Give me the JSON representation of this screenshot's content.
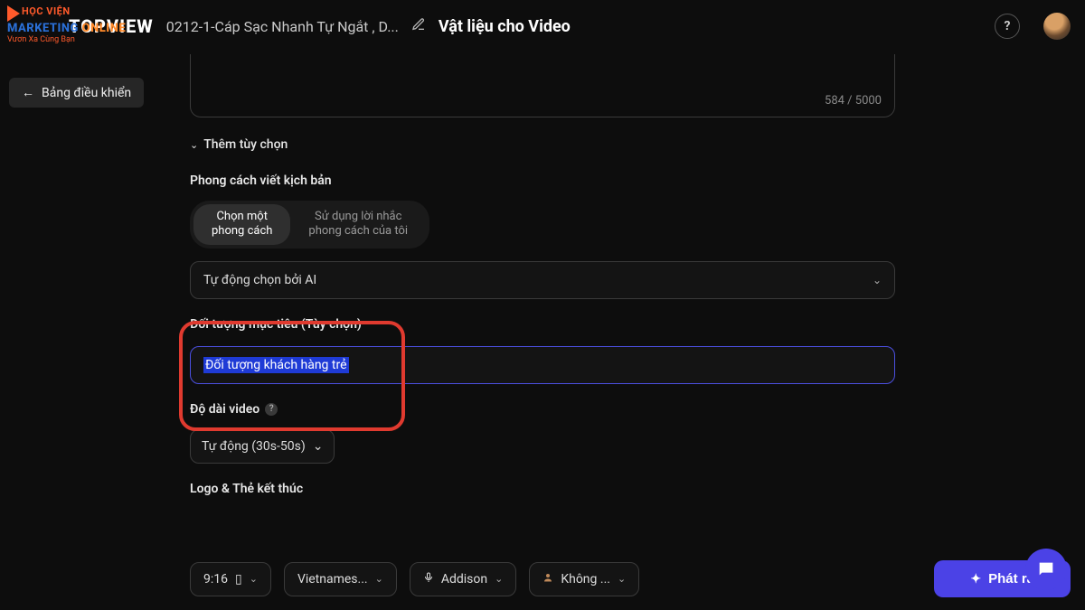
{
  "overlay_logo": {
    "line1": "HỌC VIỆN",
    "line2_a": "MARKETING",
    "line2_b": " ONLINE",
    "line3": "Vươn Xa Cùng Bạn"
  },
  "header": {
    "brand": "TOPVIEW",
    "crumb": "0212-1-Cáp Sạc Nhanh Tự Ngắt , D...",
    "title": "Vật liệu cho Video",
    "help": "?"
  },
  "back": {
    "arrow": "←",
    "label": "Bảng điều khiển"
  },
  "counter": "584 / 5000",
  "expand": {
    "chev": "⌄",
    "label": "Thêm tùy chọn"
  },
  "script_style": {
    "label": "Phong cách viết kịch bản",
    "opt1": "Chọn một\nphong cách",
    "opt2": "Sử dụng lời nhắc\nphong cách của tôi",
    "select": "Tự động chọn bởi AI"
  },
  "target": {
    "label": "Đối tượng mục tiêu (Tùy chọn)",
    "value": "Đối tượng khách hàng trẻ"
  },
  "length": {
    "label": "Độ dài video",
    "value": "Tự động (30s-50s)"
  },
  "logo_section": {
    "label": "Logo & Thẻ kết thúc"
  },
  "bottom": {
    "ratio": "9:16",
    "lang": "Vietnames...",
    "voice": "Addison",
    "avatar": "Không ...",
    "submit": "Phát ra"
  }
}
